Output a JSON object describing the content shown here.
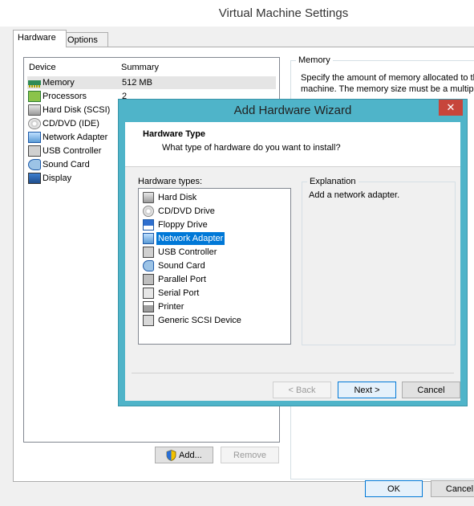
{
  "vm_window": {
    "title": "Virtual Machine Settings",
    "tabs": [
      {
        "label": "Hardware",
        "active": true
      },
      {
        "label": "Options",
        "active": false
      }
    ],
    "device_list": {
      "col_device": "Device",
      "col_summary": "Summary",
      "rows": [
        {
          "name": "Memory",
          "summary": "512 MB",
          "icon": "memory-icon",
          "selected": true
        },
        {
          "name": "Processors",
          "summary": "2",
          "icon": "processor-icon"
        },
        {
          "name": "Hard Disk (SCSI)",
          "summary": "",
          "icon": "hard-disk-icon"
        },
        {
          "name": "CD/DVD (IDE)",
          "summary": "",
          "icon": "cd-dvd-icon"
        },
        {
          "name": "Network Adapter",
          "summary": "",
          "icon": "network-adapter-icon"
        },
        {
          "name": "USB Controller",
          "summary": "",
          "icon": "usb-icon"
        },
        {
          "name": "Sound Card",
          "summary": "",
          "icon": "sound-card-icon"
        },
        {
          "name": "Display",
          "summary": "",
          "icon": "display-icon"
        }
      ]
    },
    "memory_panel": {
      "legend": "Memory",
      "desc_line1": "Specify the amount of memory allocated to th",
      "desc_line2": "machine. The memory size must be a multiple"
    },
    "buttons": {
      "add": "Add...",
      "remove": "Remove",
      "ok": "OK",
      "cancel": "Cancel"
    }
  },
  "wizard": {
    "title": "Add Hardware Wizard",
    "close_glyph": "✕",
    "header_title": "Hardware Type",
    "header_sub": "What type of hardware do you want to install?",
    "hw_types_label": "Hardware types:",
    "hw_types": [
      {
        "name": "Hard Disk",
        "icon": "hard-disk-icon"
      },
      {
        "name": "CD/DVD Drive",
        "icon": "cd-dvd-icon"
      },
      {
        "name": "Floppy Drive",
        "icon": "floppy-icon"
      },
      {
        "name": "Network Adapter",
        "icon": "network-adapter-icon",
        "selected": true
      },
      {
        "name": "USB Controller",
        "icon": "usb-icon"
      },
      {
        "name": "Sound Card",
        "icon": "sound-card-icon"
      },
      {
        "name": "Parallel Port",
        "icon": "parallel-port-icon"
      },
      {
        "name": "Serial Port",
        "icon": "serial-port-icon"
      },
      {
        "name": "Printer",
        "icon": "printer-icon"
      },
      {
        "name": "Generic SCSI Device",
        "icon": "scsi-icon"
      }
    ],
    "explanation_legend": "Explanation",
    "explanation_text": "Add a network adapter.",
    "buttons": {
      "back": "< Back",
      "next": "Next >",
      "cancel": "Cancel"
    }
  }
}
